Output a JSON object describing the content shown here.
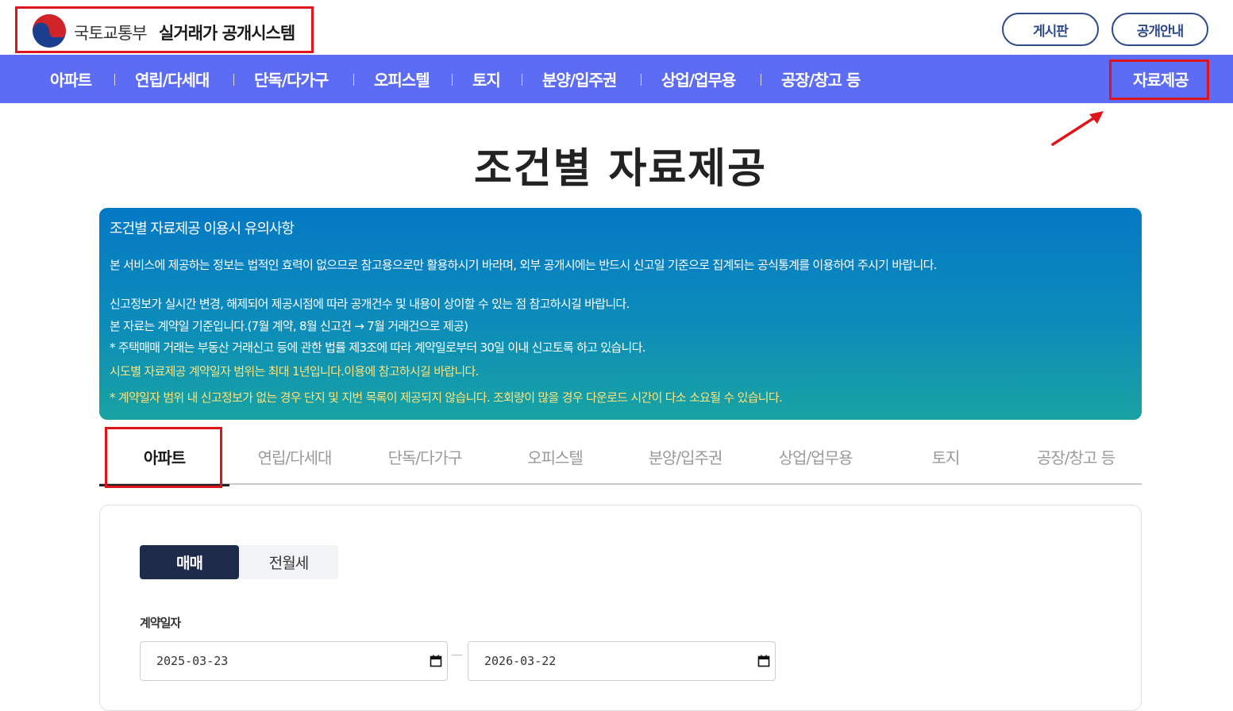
{
  "header": {
    "ministry": "국토교통부",
    "system_name": "실거래가 공개시스템",
    "buttons": [
      "게시판",
      "공개안내"
    ]
  },
  "nav": {
    "items": [
      "아파트",
      "연립/다세대",
      "단독/다가구",
      "오피스텔",
      "토지",
      "분양/입주권",
      "상업/업무용",
      "공장/창고 등"
    ],
    "data_provision": "자료제공"
  },
  "page_title": "조건별 자료제공",
  "notice": {
    "title": "조건별 자료제공 이용시 유의사항",
    "lines": [
      "본 서비스에 제공하는 정보는 법적인 효력이 없으므로 참고용으로만 활용하시기 바라며, 외부 공개시에는 반드시 신고일 기준으로 집계되는 공식통계를 이용하여 주시기 바랍니다.",
      "신고정보가 실시간 변경, 해제되어 제공시점에 따라 공개건수 및 내용이 상이할 수 있는 점 참고하시길 바랍니다.",
      "본 자료는 계약일 기준입니다.(7월 계약, 8월 신고건 → 7월 거래건으로 제공)",
      "* 주택매매 거래는 부동산 거래신고 등에 관한 법률 제3조에 따라 계약일로부터 30일 이내 신고토록 하고 있습니다.",
      "시도별 자료제공 계약일자 범위는 최대 1년입니다.이용에 참고하시길 바랍니다.",
      "* 계약일자 범위 내 신고정보가 없는 경우 단지 및 지번 목록이 제공되지 않습니다. 조회량이 많을 경우 다운로드 시간이 다소 소요될 수 있습니다."
    ]
  },
  "tabs": [
    "아파트",
    "연립/다세대",
    "단독/다가구",
    "오피스텔",
    "분양/입주권",
    "상업/업무용",
    "토지",
    "공장/창고 등"
  ],
  "active_tab": "아파트",
  "trade_type": {
    "options": [
      "매매",
      "전월세"
    ],
    "selected": "매매"
  },
  "contract_date": {
    "label": "계약일자",
    "start": "2025-03-23",
    "end": "2026-03-22"
  },
  "colors": {
    "nav_bg": "#5c6cf5",
    "highlight": "#e0141b",
    "segment_active": "#1e2a4a",
    "notice_highlight": "#ffe27a"
  }
}
